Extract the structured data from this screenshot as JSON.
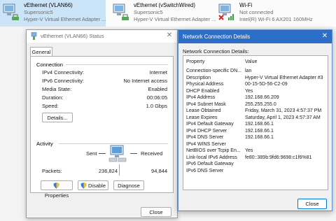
{
  "adapters": [
    {
      "name": "vEthernet (VLAN66)",
      "line2": "Supersonic5",
      "line3": "Hyper-V Virtual Ethernet Adapter ...",
      "selected": true
    },
    {
      "name": "vEthernet (vSwitchWired)",
      "line2": "Supersonic5",
      "line3": "Hyper-V Virtual Ethernet Adapter ..."
    },
    {
      "name": "Wi-Fi",
      "line2": "Not connected",
      "line3": "Intel(R) Wi-Fi 6 AX201 160MHz"
    }
  ],
  "status": {
    "title": "vEthernet (VLAN66) Status",
    "tab": "General",
    "connection_label": "Connection",
    "rows": [
      {
        "label": "IPv4 Connectivity:",
        "value": "Internet"
      },
      {
        "label": "IPv6 Connectivity:",
        "value": "No Internet access"
      },
      {
        "label": "Media State:",
        "value": "Enabled"
      },
      {
        "label": "Duration:",
        "value": "00:06:05"
      },
      {
        "label": "Speed:",
        "value": "1.0 Gbps"
      }
    ],
    "details_button": "Details...",
    "activity_label": "Activity",
    "sent_label": "Sent",
    "received_label": "Received",
    "packets_label": "Packets:",
    "packets_sent": "236,824",
    "packets_received": "94,844",
    "properties_button": "Properties",
    "disable_button": "Disable",
    "diagnose_button": "Diagnose",
    "close_button": "Close"
  },
  "details": {
    "title": "Network Connection Details",
    "label": "Network Connection Details:",
    "header_property": "Property",
    "header_value": "Value",
    "rows": [
      {
        "p": "Connection-specific DN...",
        "v": "lan"
      },
      {
        "p": "Description",
        "v": "Hyper-V Virtual Ethernet Adapter #3"
      },
      {
        "p": "Physical Address",
        "v": "00-15-5D-56-C2-09"
      },
      {
        "p": "DHCP Enabled",
        "v": "Yes"
      },
      {
        "p": "IPv4 Address",
        "v": "192.168.66.209"
      },
      {
        "p": "IPv4 Subnet Mask",
        "v": "255.255.255.0"
      },
      {
        "p": "Lease Obtained",
        "v": "Friday, March 31, 2023 4:57:37 PM"
      },
      {
        "p": "Lease Expires",
        "v": "Saturday, April 1, 2023 4:57:37 AM"
      },
      {
        "p": "IPv4 Default Gateway",
        "v": "192.168.66.1"
      },
      {
        "p": "IPv4 DHCP Server",
        "v": "192.168.66.1"
      },
      {
        "p": "IPv4 DNS Server",
        "v": "192.168.66.1"
      },
      {
        "p": "IPv4 WINS Server",
        "v": ""
      },
      {
        "p": "NetBIOS over Tcpip En...",
        "v": "Yes"
      },
      {
        "p": "Link-local IPv6 Address",
        "v": "fe80::389b:9fd6:9698:c1f6%81"
      },
      {
        "p": "IPv6 Default Gateway",
        "v": ""
      },
      {
        "p": "IPv6 DNS Server",
        "v": ""
      }
    ],
    "close_button": "Close"
  }
}
